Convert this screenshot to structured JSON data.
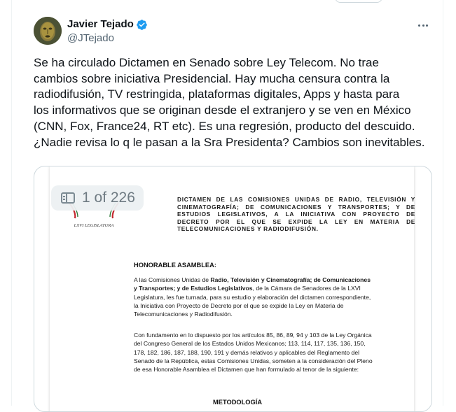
{
  "author": {
    "name": "Javier Tejado",
    "handle": "@JTejado",
    "verified": true
  },
  "tweet": {
    "lines": [
      "Se ha circulado Dictamen en Senado sobre Ley Telecom. No trae",
      "cambios sobre iniciativa Presidencial. Hay mucha censura contra la",
      "radiodifusión, TV restringida, plataformas digitales, Apps y hasta para",
      "los informativos que se originan desde el extranjero y se ven en México",
      "(CNN, Fox, France24, RT etc). Es una regresión, producto del descuido.",
      "¿Nadie revisa lo q le pasan a la Sra Presidenta?  Cambios son inevitables."
    ]
  },
  "media": {
    "page_indicator": "1 of 226",
    "seal_text": "LXVI LEGISLATURA",
    "doc_title": "DICTAMEN DE LAS COMISIONES UNIDAS DE RADIO, TELEVISIÓN Y CINEMATOGRAFÍA; DE COMUNICACIONES Y TRANSPORTES; Y DE ESTUDIOS LEGISLATIVOS, A LA INICIATIVA CON PROYECTO DE DECRETO POR EL QUE SE EXPIDE LA LEY EN MATERIA DE TELECOMUNICACIONES Y RADIODIFUSIÓN.",
    "heading": "HONORABLE ASAMBLEA:",
    "paragraph1": {
      "line1_pre": "A las Comisiones Unidas de ",
      "line1_bold": "Radio, Televisión y Cinematografía; de Comunicaciones",
      "line2_bold": "y Transportes; y de Estudios Legislativos",
      "line2_post": ", de la Cámara de Senadores de la LXVI",
      "lines": [
        "Legislatura, les fue turnada, para su estudio y elaboración del dictamen correspondiente,",
        "la Iniciativa con Proyecto de Decreto por el que se expide la Ley en Materia de",
        "Telecomunicaciones y Radiodifusión."
      ]
    },
    "paragraph2": [
      "Con fundamento en lo dispuesto por los artículos 85, 86, 89, 94 y 103 de la Ley Orgánica",
      "del Congreso General de los Estados Unidos Mexicanos; 113, 114, 117, 135, 136, 150,",
      "178, 182, 186, 187, 188, 190, 191 y demás relativos y aplicables del Reglamento del",
      "Senado de la República, estas Comisiones Unidas, someten a la consideración del Pleno",
      "de esa Honorable Asamblea el Dictamen que han formulado al tenor de la siguiente:"
    ],
    "section_heading": "METODOLOGÍA"
  },
  "colors": {
    "text": "#0f1419",
    "secondary": "#536471",
    "verified_blue": "#1d9bf0",
    "border": "#cfd9de"
  }
}
